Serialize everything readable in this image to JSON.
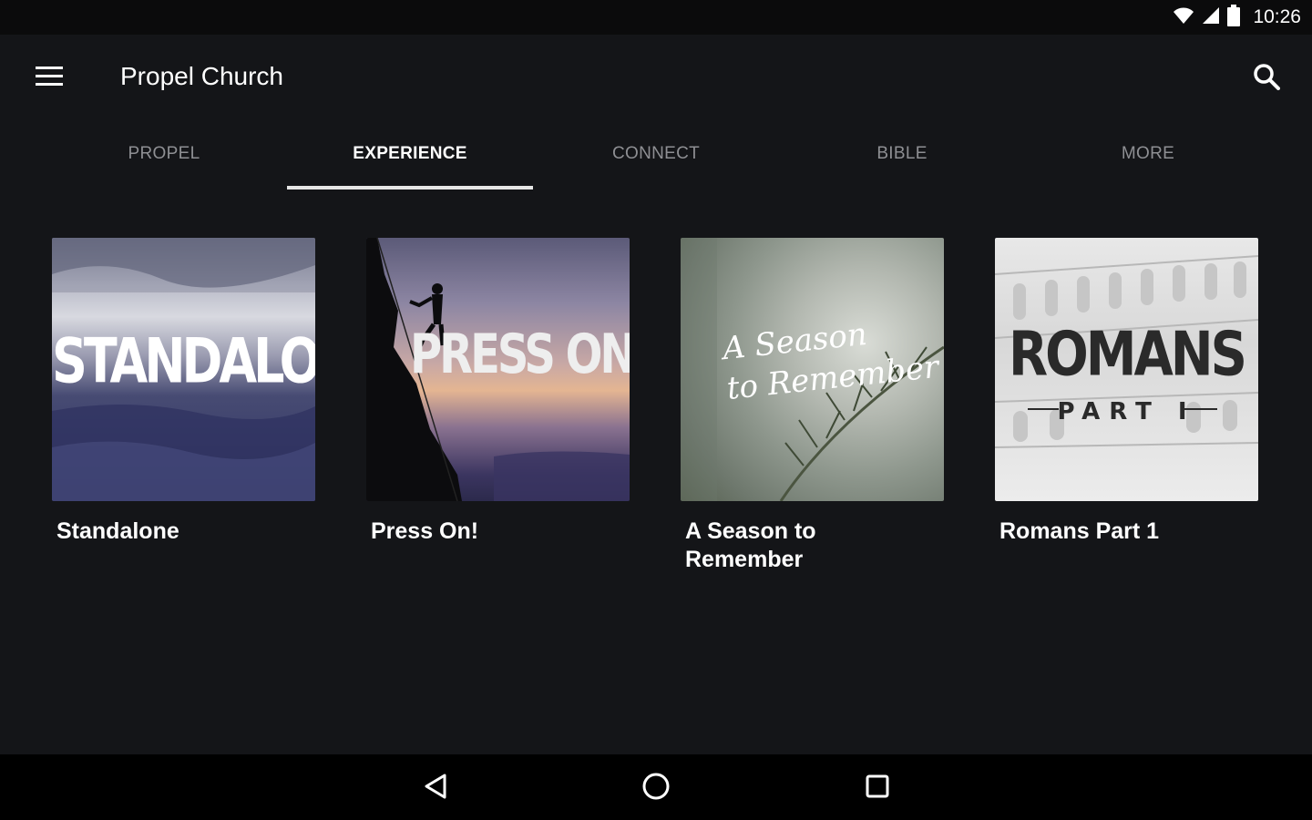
{
  "status_bar": {
    "time": "10:26",
    "icons": [
      "wifi-icon",
      "cell-signal-icon",
      "battery-icon"
    ]
  },
  "app_bar": {
    "title": "Propel Church",
    "menu_icon": "hamburger-menu-icon",
    "search_icon": "search-icon"
  },
  "tabs": [
    {
      "label": "PROPEL",
      "active": false
    },
    {
      "label": "EXPERIENCE",
      "active": true
    },
    {
      "label": "CONNECT",
      "active": false
    },
    {
      "label": "BIBLE",
      "active": false
    },
    {
      "label": "MORE",
      "active": false
    }
  ],
  "series": [
    {
      "title": "Standalone",
      "artwork_text": "STANDALONE"
    },
    {
      "title": "Press On!",
      "artwork_text": "PRESS ON!"
    },
    {
      "title": "A Season to Remember",
      "artwork_text": "A Season\nto Remember"
    },
    {
      "title": "Romans Part 1",
      "artwork_text": "ROMANS",
      "artwork_subtext": "PART I"
    }
  ],
  "nav_bar": {
    "icons": [
      "back-icon",
      "home-icon",
      "recents-icon"
    ]
  },
  "colors": {
    "background": "#141518",
    "status_bar": "#0b0b0c",
    "nav_bar": "#000000",
    "tab_inactive": "#8e8f93",
    "tab_active": "#ffffff",
    "indicator": "#e6e6e6"
  }
}
